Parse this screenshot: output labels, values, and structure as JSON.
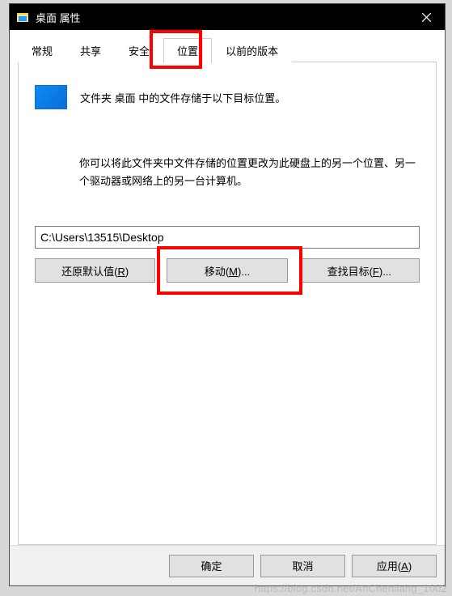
{
  "title": "桌面 属性",
  "tabs": {
    "general": "常规",
    "sharing": "共享",
    "security": "安全",
    "location": "位置",
    "previous": "以前的版本"
  },
  "panel": {
    "desc": "文件夹 桌面 中的文件存储于以下目标位置。",
    "info": "你可以将此文件夹中文件存储的位置更改为此硬盘上的另一个位置、另一个驱动器或网络上的另一台计算机。",
    "path": "C:\\Users\\13515\\Desktop",
    "restore_prefix": "还原默认值(",
    "restore_key": "R",
    "restore_suffix": ")",
    "move_prefix": "移动(",
    "move_key": "M",
    "move_suffix": ")...",
    "find_prefix": "查找目标(",
    "find_key": "F",
    "find_suffix": ")..."
  },
  "footer": {
    "ok": "确定",
    "cancel": "取消",
    "apply_prefix": "应用(",
    "apply_key": "A",
    "apply_suffix": ")"
  },
  "watermark": "https://blog.csdn.net/AnChenliang_1002"
}
